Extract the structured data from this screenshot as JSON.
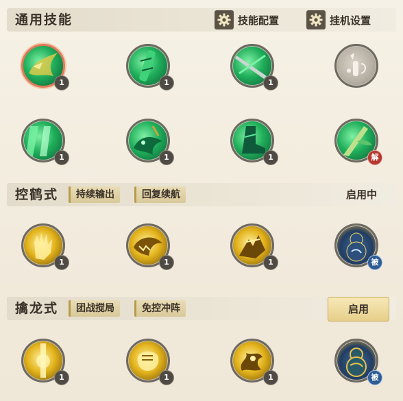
{
  "general": {
    "title": "通用技能",
    "skill_config_label": "技能配置",
    "auto_settings_label": "挂机设置",
    "skills": [
      {
        "level": "1",
        "icon": "dragon-icon"
      },
      {
        "level": "1",
        "icon": "bamboo-icon"
      },
      {
        "level": "1",
        "icon": "sword-icon"
      },
      {
        "level": "",
        "icon": "locked-skill-icon"
      },
      {
        "level": "1",
        "icon": "green-slash-icon"
      },
      {
        "level": "1",
        "icon": "beast-icon"
      },
      {
        "level": "1",
        "icon": "boot-icon"
      },
      {
        "level": "",
        "icon": "bamboo-leaf-icon",
        "badge": "解"
      }
    ]
  },
  "crane": {
    "title": "控鹤式",
    "tags": [
      "持续输出",
      "回复续航"
    ],
    "status": "启用中",
    "skills": [
      {
        "level": "1",
        "icon": "golden-hand-icon"
      },
      {
        "level": "1",
        "icon": "golden-dragon-icon"
      },
      {
        "level": "1",
        "icon": "golden-claw-icon"
      },
      {
        "level": "",
        "icon": "gourd-icon",
        "badge": "被"
      }
    ]
  },
  "dragon": {
    "title": "擒龙式",
    "tags": [
      "团战搅局",
      "免控冲阵"
    ],
    "enable_label": "启用",
    "skills": [
      {
        "level": "1",
        "icon": "golden-burst-icon"
      },
      {
        "level": "1",
        "icon": "golden-fist-icon"
      },
      {
        "level": "1",
        "icon": "golden-serpent-icon"
      },
      {
        "level": "",
        "icon": "gold-gourd-icon",
        "badge": "被"
      }
    ]
  }
}
